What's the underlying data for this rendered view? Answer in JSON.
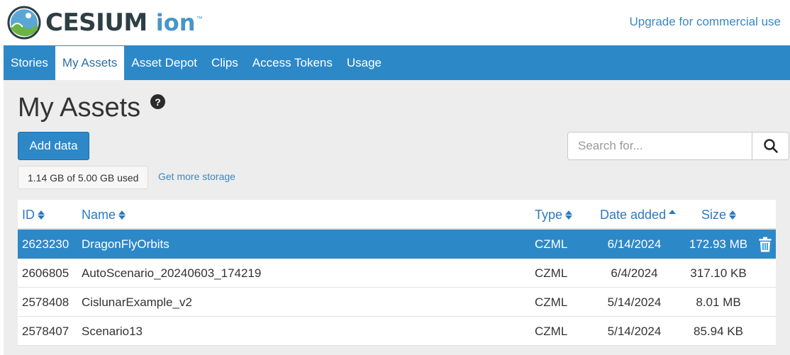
{
  "brand": {
    "name": "CESIUM",
    "product": "ion",
    "tm": "™"
  },
  "header": {
    "upgrade_link": "Upgrade for commercial use"
  },
  "nav": {
    "items": [
      {
        "label": "Stories",
        "active": false
      },
      {
        "label": "My Assets",
        "active": true
      },
      {
        "label": "Asset Depot",
        "active": false
      },
      {
        "label": "Clips",
        "active": false
      },
      {
        "label": "Access Tokens",
        "active": false
      },
      {
        "label": "Usage",
        "active": false
      }
    ]
  },
  "page": {
    "title": "My Assets",
    "help_glyph": "?",
    "add_button": "Add data",
    "search_placeholder": "Search for...",
    "storage_used": "1.14 GB of 5.00 GB used",
    "get_more_storage": "Get more storage"
  },
  "table": {
    "columns": {
      "id": "ID",
      "name": "Name",
      "type": "Type",
      "date_added": "Date added",
      "size": "Size"
    },
    "sorted_by": "date_added",
    "rows": [
      {
        "id": "2623230",
        "name": "DragonFlyOrbits",
        "type": "CZML",
        "date_added": "6/14/2024",
        "size": "172.93 MB",
        "selected": true
      },
      {
        "id": "2606805",
        "name": "AutoScenario_20240603_174219",
        "type": "CZML",
        "date_added": "6/4/2024",
        "size": "317.10 KB",
        "selected": false
      },
      {
        "id": "2578408",
        "name": "CislunarExample_v2",
        "type": "CZML",
        "date_added": "5/14/2024",
        "size": "8.01 MB",
        "selected": false
      },
      {
        "id": "2578407",
        "name": "Scenario13",
        "type": "CZML",
        "date_added": "5/14/2024",
        "size": "85.94 KB",
        "selected": false
      }
    ]
  },
  "colors": {
    "accent": "#2d88c8",
    "link": "#3b86c5",
    "logo_dark": "#2e3e45",
    "content_bg": "#ededed"
  },
  "icons": {
    "logo": "cesium-globe-logo",
    "help": "help-circle-icon",
    "search": "magnifier-icon",
    "delete": "trash-icon"
  }
}
